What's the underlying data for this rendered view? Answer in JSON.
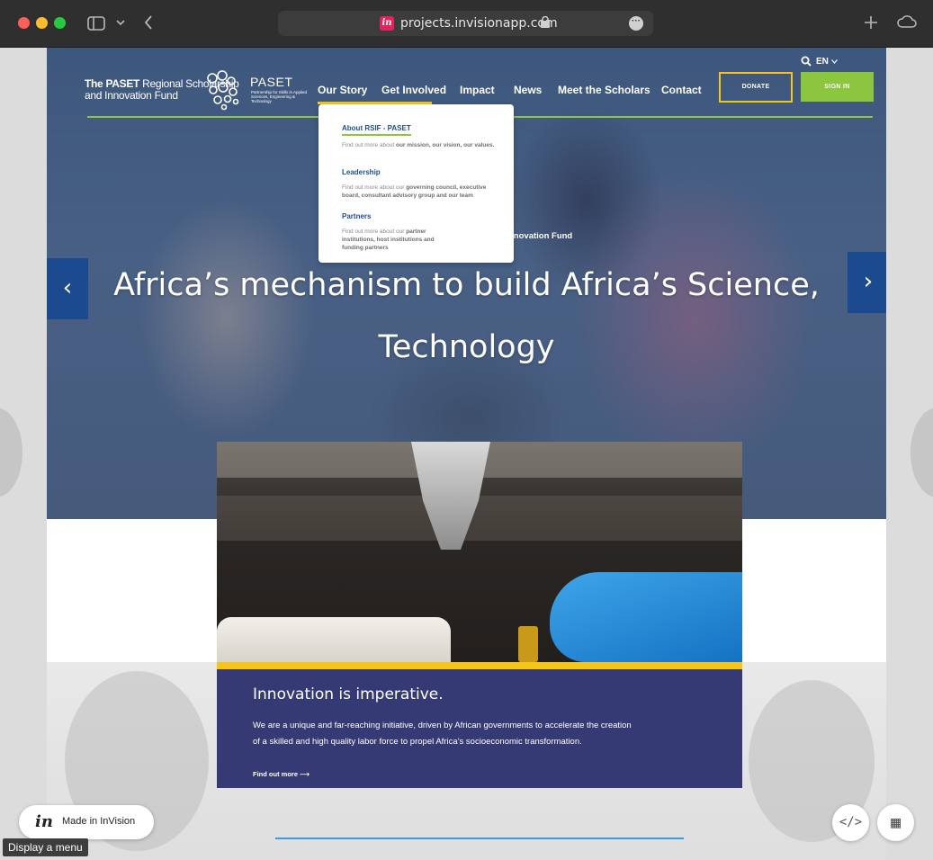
{
  "browser": {
    "url": "projects.invisionapp.com",
    "logo_letter": "in",
    "more_glyph": "···"
  },
  "site": {
    "logo_line1_bold": "The PASET",
    "logo_line1_rest": " Regional Scholarship",
    "logo_line2": "and Innovation Fund",
    "paset_name": "PASET",
    "paset_tagline": "Partnership for Skills in Applied Sciences, Engineering & Technology",
    "nav": [
      "Our Story",
      "Get Involved",
      "Impact",
      "News",
      "Meet the Scholars",
      "Contact"
    ],
    "active_nav": "Our Story",
    "donate_label": "DONATE",
    "signin_label": "SIGN IN",
    "language": "EN",
    "colors": {
      "accent_yellow": "#f5c518",
      "accent_green": "#8cc63f",
      "brand_blue": "#1c4a8e"
    }
  },
  "dropdown": {
    "items": [
      {
        "title": "About RSIF - PASET",
        "desc_pre": "Find out more about ",
        "desc_bold": "our mission, our vision, our values."
      },
      {
        "title": "Leadership",
        "desc_pre": "Find out more about our ",
        "desc_bold": "governing council, executive board, consultant advisory group and our team"
      },
      {
        "title": "Partners",
        "desc_pre": "Find out more about our ",
        "desc_bold": "partner institutions, host institutions and funding partners"
      }
    ]
  },
  "hero": {
    "overlap_text": "nnovation Fund",
    "title_line1": "Africa’s mechanism to build Africa’s Science,",
    "title_line2": "Technology",
    "prev_glyph": "‹",
    "next_glyph": "›"
  },
  "card": {
    "heading": "Innovation is imperative.",
    "body": "We are a unique and far-reaching initiative, driven by African governments to accelerate the creation of a skilled and high quality labor force to propel Africa’s socioeconomic transformation.",
    "link": "Find out more ⟶"
  },
  "invision": {
    "made_in": "Made in InVision",
    "tooltip": "Display a menu",
    "code_glyph": "</>",
    "grid_glyph": "▦"
  }
}
